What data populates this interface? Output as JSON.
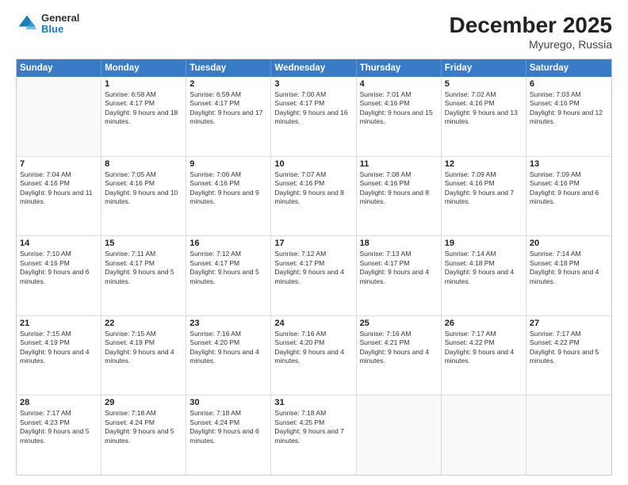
{
  "header": {
    "logo_general": "General",
    "logo_blue": "Blue",
    "month_title": "December 2025",
    "location": "Myurego, Russia"
  },
  "days_of_week": [
    "Sunday",
    "Monday",
    "Tuesday",
    "Wednesday",
    "Thursday",
    "Friday",
    "Saturday"
  ],
  "weeks": [
    [
      {
        "day": "",
        "sunrise": "",
        "sunset": "",
        "daylight": "",
        "empty": true
      },
      {
        "day": "1",
        "sunrise": "Sunrise: 6:58 AM",
        "sunset": "Sunset: 4:17 PM",
        "daylight": "Daylight: 9 hours and 18 minutes."
      },
      {
        "day": "2",
        "sunrise": "Sunrise: 6:59 AM",
        "sunset": "Sunset: 4:17 PM",
        "daylight": "Daylight: 9 hours and 17 minutes."
      },
      {
        "day": "3",
        "sunrise": "Sunrise: 7:00 AM",
        "sunset": "Sunset: 4:17 PM",
        "daylight": "Daylight: 9 hours and 16 minutes."
      },
      {
        "day": "4",
        "sunrise": "Sunrise: 7:01 AM",
        "sunset": "Sunset: 4:16 PM",
        "daylight": "Daylight: 9 hours and 15 minutes."
      },
      {
        "day": "5",
        "sunrise": "Sunrise: 7:02 AM",
        "sunset": "Sunset: 4:16 PM",
        "daylight": "Daylight: 9 hours and 13 minutes."
      },
      {
        "day": "6",
        "sunrise": "Sunrise: 7:03 AM",
        "sunset": "Sunset: 4:16 PM",
        "daylight": "Daylight: 9 hours and 12 minutes."
      }
    ],
    [
      {
        "day": "7",
        "sunrise": "Sunrise: 7:04 AM",
        "sunset": "Sunset: 4:16 PM",
        "daylight": "Daylight: 9 hours and 11 minutes."
      },
      {
        "day": "8",
        "sunrise": "Sunrise: 7:05 AM",
        "sunset": "Sunset: 4:16 PM",
        "daylight": "Daylight: 9 hours and 10 minutes."
      },
      {
        "day": "9",
        "sunrise": "Sunrise: 7:06 AM",
        "sunset": "Sunset: 4:16 PM",
        "daylight": "Daylight: 9 hours and 9 minutes."
      },
      {
        "day": "10",
        "sunrise": "Sunrise: 7:07 AM",
        "sunset": "Sunset: 4:16 PM",
        "daylight": "Daylight: 9 hours and 8 minutes."
      },
      {
        "day": "11",
        "sunrise": "Sunrise: 7:08 AM",
        "sunset": "Sunset: 4:16 PM",
        "daylight": "Daylight: 9 hours and 8 minutes."
      },
      {
        "day": "12",
        "sunrise": "Sunrise: 7:09 AM",
        "sunset": "Sunset: 4:16 PM",
        "daylight": "Daylight: 9 hours and 7 minutes."
      },
      {
        "day": "13",
        "sunrise": "Sunrise: 7:09 AM",
        "sunset": "Sunset: 4:16 PM",
        "daylight": "Daylight: 9 hours and 6 minutes."
      }
    ],
    [
      {
        "day": "14",
        "sunrise": "Sunrise: 7:10 AM",
        "sunset": "Sunset: 4:16 PM",
        "daylight": "Daylight: 9 hours and 6 minutes."
      },
      {
        "day": "15",
        "sunrise": "Sunrise: 7:11 AM",
        "sunset": "Sunset: 4:17 PM",
        "daylight": "Daylight: 9 hours and 5 minutes."
      },
      {
        "day": "16",
        "sunrise": "Sunrise: 7:12 AM",
        "sunset": "Sunset: 4:17 PM",
        "daylight": "Daylight: 9 hours and 5 minutes."
      },
      {
        "day": "17",
        "sunrise": "Sunrise: 7:12 AM",
        "sunset": "Sunset: 4:17 PM",
        "daylight": "Daylight: 9 hours and 4 minutes."
      },
      {
        "day": "18",
        "sunrise": "Sunrise: 7:13 AM",
        "sunset": "Sunset: 4:17 PM",
        "daylight": "Daylight: 9 hours and 4 minutes."
      },
      {
        "day": "19",
        "sunrise": "Sunrise: 7:14 AM",
        "sunset": "Sunset: 4:18 PM",
        "daylight": "Daylight: 9 hours and 4 minutes."
      },
      {
        "day": "20",
        "sunrise": "Sunrise: 7:14 AM",
        "sunset": "Sunset: 4:18 PM",
        "daylight": "Daylight: 9 hours and 4 minutes."
      }
    ],
    [
      {
        "day": "21",
        "sunrise": "Sunrise: 7:15 AM",
        "sunset": "Sunset: 4:19 PM",
        "daylight": "Daylight: 9 hours and 4 minutes."
      },
      {
        "day": "22",
        "sunrise": "Sunrise: 7:15 AM",
        "sunset": "Sunset: 4:19 PM",
        "daylight": "Daylight: 9 hours and 4 minutes."
      },
      {
        "day": "23",
        "sunrise": "Sunrise: 7:16 AM",
        "sunset": "Sunset: 4:20 PM",
        "daylight": "Daylight: 9 hours and 4 minutes."
      },
      {
        "day": "24",
        "sunrise": "Sunrise: 7:16 AM",
        "sunset": "Sunset: 4:20 PM",
        "daylight": "Daylight: 9 hours and 4 minutes."
      },
      {
        "day": "25",
        "sunrise": "Sunrise: 7:16 AM",
        "sunset": "Sunset: 4:21 PM",
        "daylight": "Daylight: 9 hours and 4 minutes."
      },
      {
        "day": "26",
        "sunrise": "Sunrise: 7:17 AM",
        "sunset": "Sunset: 4:22 PM",
        "daylight": "Daylight: 9 hours and 4 minutes."
      },
      {
        "day": "27",
        "sunrise": "Sunrise: 7:17 AM",
        "sunset": "Sunset: 4:22 PM",
        "daylight": "Daylight: 9 hours and 5 minutes."
      }
    ],
    [
      {
        "day": "28",
        "sunrise": "Sunrise: 7:17 AM",
        "sunset": "Sunset: 4:23 PM",
        "daylight": "Daylight: 9 hours and 5 minutes."
      },
      {
        "day": "29",
        "sunrise": "Sunrise: 7:18 AM",
        "sunset": "Sunset: 4:24 PM",
        "daylight": "Daylight: 9 hours and 5 minutes."
      },
      {
        "day": "30",
        "sunrise": "Sunrise: 7:18 AM",
        "sunset": "Sunset: 4:24 PM",
        "daylight": "Daylight: 9 hours and 6 minutes."
      },
      {
        "day": "31",
        "sunrise": "Sunrise: 7:18 AM",
        "sunset": "Sunset: 4:25 PM",
        "daylight": "Daylight: 9 hours and 7 minutes."
      },
      {
        "day": "",
        "sunrise": "",
        "sunset": "",
        "daylight": "",
        "empty": true
      },
      {
        "day": "",
        "sunrise": "",
        "sunset": "",
        "daylight": "",
        "empty": true
      },
      {
        "day": "",
        "sunrise": "",
        "sunset": "",
        "daylight": "",
        "empty": true
      }
    ]
  ]
}
